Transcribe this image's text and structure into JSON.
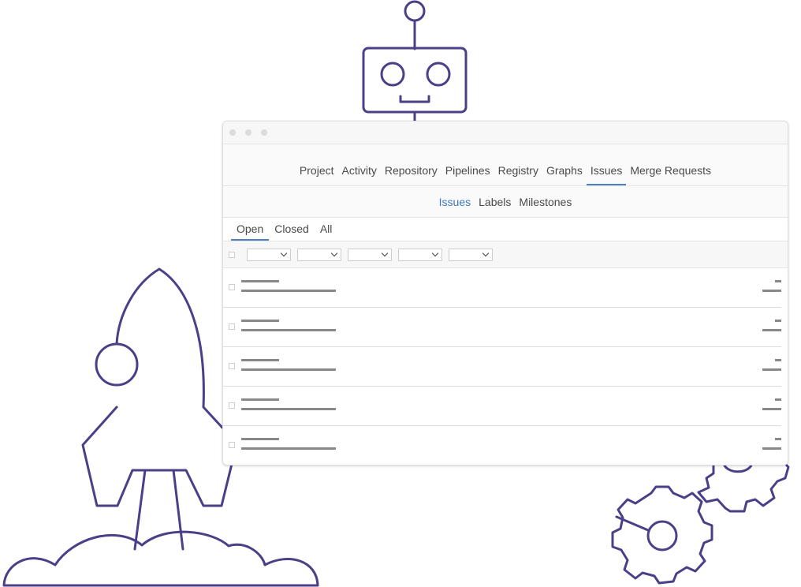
{
  "navbar": {
    "items": [
      {
        "label": "Project"
      },
      {
        "label": "Activity"
      },
      {
        "label": "Repository"
      },
      {
        "label": "Pipelines"
      },
      {
        "label": "Registry"
      },
      {
        "label": "Graphs"
      },
      {
        "label": "Issues",
        "active": true
      },
      {
        "label": "Merge Requests"
      }
    ]
  },
  "subnav": {
    "items": [
      {
        "label": "Issues",
        "active": true
      },
      {
        "label": "Labels"
      },
      {
        "label": "Milestones"
      }
    ]
  },
  "state_tabs": [
    {
      "label": "Open",
      "active": true
    },
    {
      "label": "Closed"
    },
    {
      "label": "All"
    }
  ],
  "filters": {
    "dropdown_count": 5
  },
  "issues": {
    "row_count": 5
  },
  "colors": {
    "illustration_stroke": "#4b3f87",
    "active_tab": "#4a7fc1",
    "active_link": "#3e78c4",
    "placeholder_bar": "#888888"
  },
  "icons": [
    "robot-icon",
    "rocket-icon",
    "gear-icon",
    "chevron-down-icon",
    "checkbox-icon"
  ]
}
